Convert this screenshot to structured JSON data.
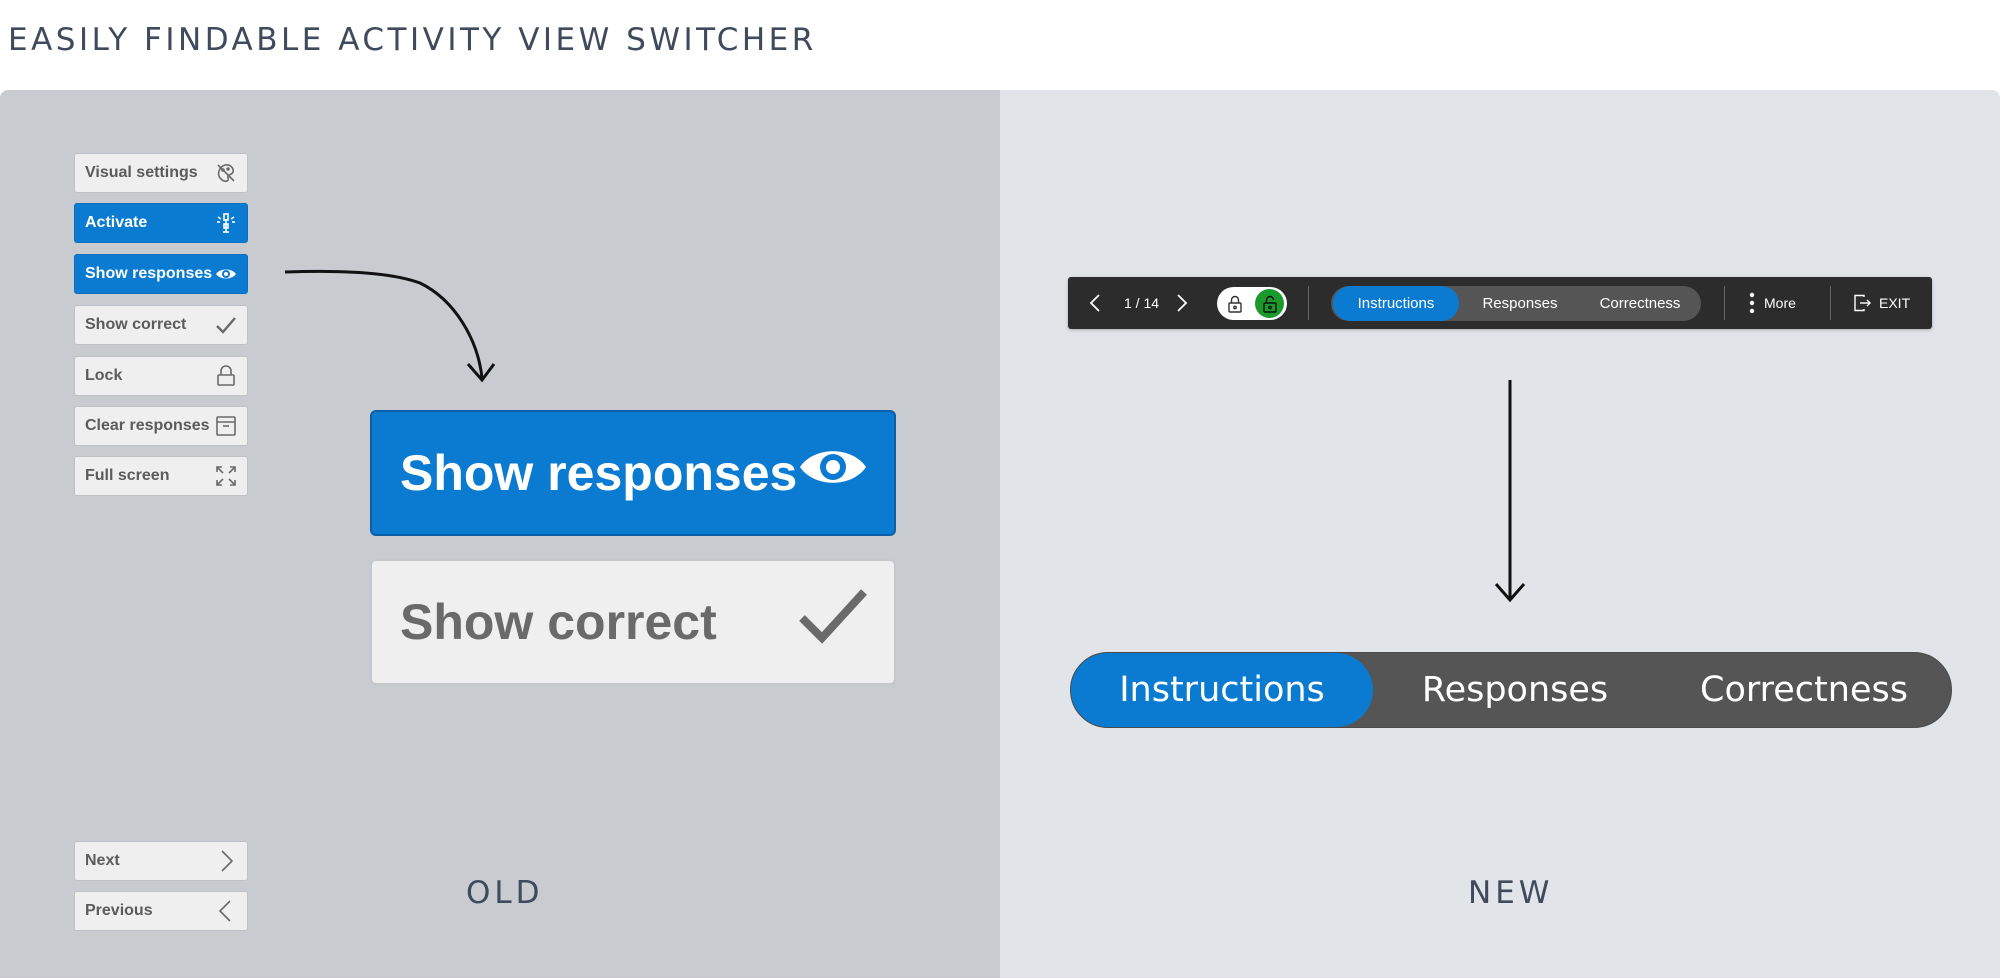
{
  "page": {
    "title": "EASILY FINDABLE ACTIVITY VIEW SWITCHER",
    "old_label": "OLD",
    "new_label": "NEW"
  },
  "old_sidebar": {
    "items": [
      {
        "label": "Visual settings",
        "icon": "visual-settings-icon",
        "active": false
      },
      {
        "label": "Activate",
        "icon": "activate-icon",
        "active": true
      },
      {
        "label": "Show responses",
        "icon": "eye-icon",
        "active": true
      },
      {
        "label": "Show correct",
        "icon": "checkmark-icon",
        "active": false
      },
      {
        "label": "Lock",
        "icon": "lock-icon",
        "active": false
      },
      {
        "label": "Clear responses",
        "icon": "archive-icon",
        "active": false
      },
      {
        "label": "Full screen",
        "icon": "fullscreen-icon",
        "active": false
      }
    ],
    "nav": [
      {
        "label": "Next",
        "icon": "chevron-right-icon"
      },
      {
        "label": "Previous",
        "icon": "chevron-left-icon"
      }
    ]
  },
  "old_zoom": {
    "responses_label": "Show responses",
    "correct_label": "Show correct"
  },
  "toolbar": {
    "page_counter": "1 / 14",
    "tabs": [
      "Instructions",
      "Responses",
      "Correctness"
    ],
    "active_tab": "Instructions",
    "more_label": "More",
    "exit_label": "EXIT"
  },
  "big_switcher": {
    "tabs": [
      "Instructions",
      "Responses",
      "Correctness"
    ],
    "active_tab": "Instructions"
  },
  "colors": {
    "accent_blue": "#0a7bd1",
    "unlock_green": "#1a9a2a",
    "toolbar_bg": "#2c2c2c",
    "segment_bg": "#555555"
  }
}
